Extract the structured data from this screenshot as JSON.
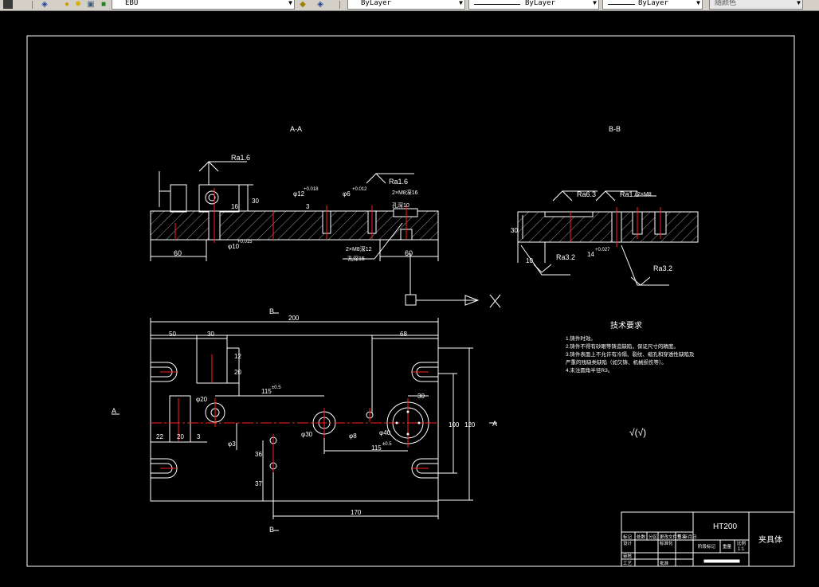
{
  "toolbar": {
    "layer_name": "EBU",
    "linetype_1": "ByLayer",
    "linetype_2": "ByLayer",
    "lineweight": "ByLayer",
    "color": "随颜色"
  },
  "drawing": {
    "section_aa": "A-A",
    "section_bb": "B-B",
    "ra16_a": "Ra1.6",
    "ra16_b": "Ra1.6",
    "ra16_c": "Ra1.6",
    "ra63": "Ra6.3",
    "ra32_a": "Ra3.2",
    "ra32_b": "Ra3.2",
    "dim_60_left": "60",
    "dim_60_right": "60",
    "dim_30_v": "30",
    "dim_16": "16",
    "dim_3": "3",
    "dim_phi10": "φ10",
    "dim_phi10_tol": "+0.015",
    "dim_phi12": "φ12",
    "dim_phi12_tol": "+0.018",
    "dim_phi6": "φ6",
    "dim_phi6_tol": "+0.012",
    "hole_note_1": "2×M8深16",
    "hole_note_2": "孔深10",
    "hole_note_3": "2×M8深12",
    "hole_note_4": "孔深15",
    "dim_10": "10",
    "dim_14": "14",
    "dim_14_tol": "+0.027",
    "dim_bb_30": "30",
    "dim_2x": "2×M8",
    "b_label_top": "B",
    "b_label_bottom": "B",
    "a_label_left": "A",
    "a_label_right": "A",
    "dim_200": "200",
    "dim_50": "50",
    "dim_30_top": "30",
    "dim_68": "68",
    "dim_12": "12",
    "dim_20": "20",
    "dim_115_a": "115",
    "dim_115_b": "115",
    "dim_tol_a": "±0.5",
    "dim_tol_b": "±0.5",
    "dim_r30": "30",
    "dim_100": "100",
    "dim_120": "120",
    "dim_22": "22",
    "dim_20b": "20",
    "dim_3b": "3",
    "dim_36": "36",
    "dim_37": "37",
    "dim_170": "170",
    "dim_phi20": "φ20",
    "dim_phi30": "φ30",
    "dim_phi8": "φ8",
    "dim_phi40": "φ40",
    "dim_phi3": "φ3",
    "tech_title": "技术要求",
    "tech_lines": [
      "1.铸件时效。",
      "2.铸件不得有砂眼等铸造缺陷，保证尺寸的精度。",
      "3.铸件表面上不允许有冷隔、裂纹、缩孔和穿透性缺陷及",
      "严重的残缺类缺陷（如欠铸、机械损伤等）。",
      "4.未注圆角半径R3。"
    ],
    "rough_symbol": "√(√)",
    "tb_material": "HT200",
    "tb_name": "夹具体",
    "tb_scale": "1:1",
    "tb_r1": "标记",
    "tb_r2": "处数",
    "tb_r3": "分区",
    "tb_r4": "更改文件号",
    "tb_r5": "签名",
    "tb_r6": "年月日",
    "tb_design": "设计",
    "tb_check": "审核",
    "tb_craft": "工艺",
    "tb_std": "标准化",
    "tb_approve": "批准",
    "tb_stage": "阶段标记",
    "tb_weight": "重量",
    "tb_ratio": "比例"
  },
  "colors": {
    "background": "#000000",
    "line": "#ffffff",
    "center": "#ff2020",
    "hatch": "#ffffff"
  }
}
